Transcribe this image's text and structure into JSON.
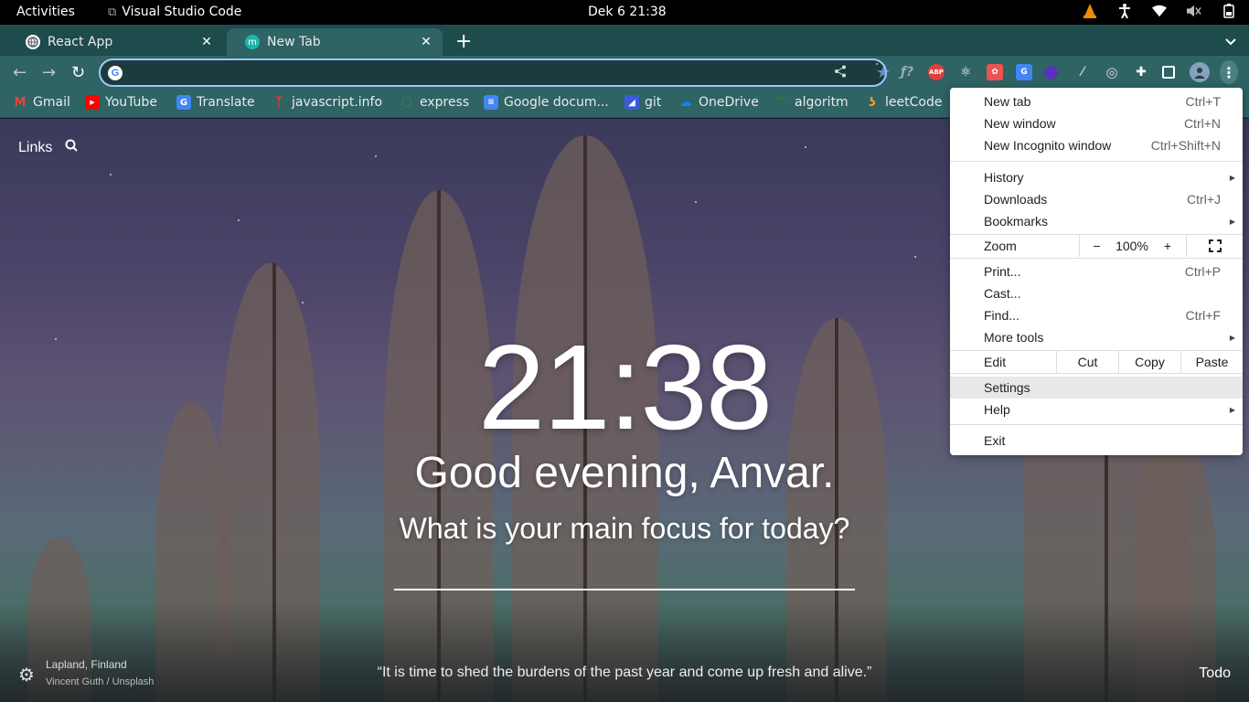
{
  "topbar": {
    "activities": "Activities",
    "app_name": "Visual Studio Code",
    "clock": "Dek 6  21:38",
    "icons": [
      "vlc-icon",
      "accessibility-icon",
      "wifi-icon",
      "volume-muted-icon",
      "battery-icon"
    ]
  },
  "tabs": [
    {
      "title": "React App",
      "favicon": "react-app-favicon"
    },
    {
      "title": "New Tab",
      "favicon": "momentum-favicon",
      "active": true
    }
  ],
  "omnibox": {
    "value": "",
    "placeholder": ""
  },
  "bookmarks": [
    {
      "label": "Gmail",
      "icon": "gmail-icon",
      "color": "#ea4335"
    },
    {
      "label": "YouTube",
      "icon": "youtube-icon",
      "color": "#ff0000"
    },
    {
      "label": "Translate",
      "icon": "translate-icon",
      "color": "#4285f4"
    },
    {
      "label": "javascript.info",
      "icon": "js-info-icon",
      "color": "#c0392b"
    },
    {
      "label": "express",
      "icon": "express-icon",
      "color": "#3c873a"
    },
    {
      "label": "Google docum...",
      "icon": "google-docs-icon",
      "color": "#4285f4"
    },
    {
      "label": "git",
      "icon": "git-icon",
      "color": "#3b5bdb"
    },
    {
      "label": "OneDrive",
      "icon": "onedrive-icon",
      "color": "#0078d4"
    },
    {
      "label": "algoritm",
      "icon": "algoritm-icon",
      "color": "#2e7d32"
    },
    {
      "label": "leetCode",
      "icon": "leetcode-icon",
      "color": "#f89f1b"
    }
  ],
  "momentum": {
    "links_label": "Links",
    "time": "21:38",
    "greeting": "Good evening, Anvar.",
    "focus_question": "What is your main focus for today?",
    "focus_value": "",
    "location": "Lapland, Finland",
    "photo_credit": "Vincent Guth / Unsplash",
    "quote": "“It is time to shed the burdens of the past year and come up fresh and alive.”",
    "todo_label": "Todo"
  },
  "menu": {
    "new_tab": {
      "label": "New tab",
      "shortcut": "Ctrl+T"
    },
    "new_window": {
      "label": "New window",
      "shortcut": "Ctrl+N"
    },
    "new_incognito": {
      "label": "New Incognito window",
      "shortcut": "Ctrl+Shift+N"
    },
    "history": {
      "label": "History"
    },
    "downloads": {
      "label": "Downloads",
      "shortcut": "Ctrl+J"
    },
    "bookmarks": {
      "label": "Bookmarks"
    },
    "zoom": {
      "label": "Zoom",
      "minus": "−",
      "value": "100%",
      "plus": "+"
    },
    "print": {
      "label": "Print...",
      "shortcut": "Ctrl+P"
    },
    "cast": {
      "label": "Cast..."
    },
    "find": {
      "label": "Find...",
      "shortcut": "Ctrl+F"
    },
    "more_tools": {
      "label": "More tools"
    },
    "edit": {
      "label": "Edit",
      "cut": "Cut",
      "copy": "Copy",
      "paste": "Paste"
    },
    "settings": {
      "label": "Settings"
    },
    "help": {
      "label": "Help"
    },
    "exit": {
      "label": "Exit"
    }
  }
}
